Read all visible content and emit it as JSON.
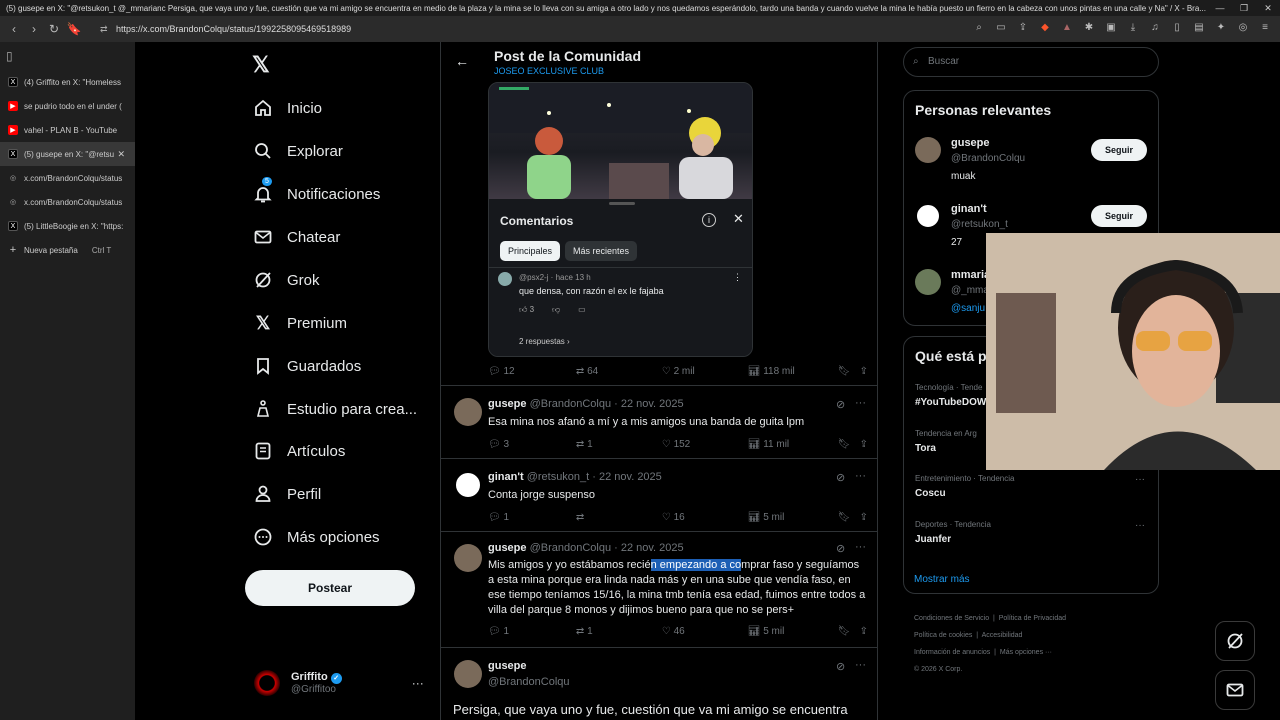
{
  "window_title": "(5) gusepe en X: \"@retsukon_t @_mmarianc Persiga, que vaya uno y fue, cuestión que va mi amigo se encuentra en medio de la plaza y la mina se lo lleva con su amiga a otro lado y nos quedamos esperándolo, tardo una banda y cuando vuelve la mina le había puesto un fierro en la cabeza con unos pintas en una calle y Na\" / X - Bra...",
  "url": "https://x.com/BrandonColqu/status/1992258095469518989",
  "tabs": [
    {
      "label": "(4) Griffito en X: \"Homeless",
      "icon": "x-favicon"
    },
    {
      "label": "se pudrio todo en el under (",
      "icon": "youtube-favicon"
    },
    {
      "label": "vahel - PLAN B - YouTube",
      "icon": "youtube-favicon"
    },
    {
      "label": "(5) gusepe en X: \"@retsu",
      "icon": "x-favicon",
      "active": true
    },
    {
      "label": "x.com/BrandonColqu/status",
      "icon": "globe-favicon"
    },
    {
      "label": "x.com/BrandonColqu/status",
      "icon": "globe-favicon"
    },
    {
      "label": "(5) LittleBoogie en X: \"https:",
      "icon": "x-favicon"
    }
  ],
  "new_tab": {
    "label": "Nueva pestaña",
    "shortcut": "Ctrl  T"
  },
  "nav": {
    "items": [
      {
        "label": "Inicio",
        "icon": "home-icon"
      },
      {
        "label": "Explorar",
        "icon": "search-icon"
      },
      {
        "label": "Notificaciones",
        "icon": "bell-icon",
        "badge": "5"
      },
      {
        "label": "Chatear",
        "icon": "mail-icon"
      },
      {
        "label": "Grok",
        "icon": "grok-icon"
      },
      {
        "label": "Premium",
        "icon": "x-logo-icon"
      },
      {
        "label": "Guardados",
        "icon": "bookmark-icon"
      },
      {
        "label": "Estudio para crea...",
        "icon": "studio-icon"
      },
      {
        "label": "Artículos",
        "icon": "article-icon"
      },
      {
        "label": "Perfil",
        "icon": "person-icon"
      },
      {
        "label": "Más opciones",
        "icon": "more-circle-icon"
      }
    ],
    "post_button": "Postear"
  },
  "account": {
    "name": "Griffito",
    "handle": "@Griffitoo"
  },
  "header": {
    "title": "Post de la Comunidad",
    "subtitle": "JOSEO EXCLUSIVE CLUB"
  },
  "comments_panel": {
    "title": "Comentarios",
    "tabs": [
      "Principales",
      "Más recientes"
    ],
    "comment_meta": "@psx2-j · hace 13 h",
    "comment_text": "que densa, con razón el ex le fajaba",
    "likes": "3",
    "replies": "2 respuestas"
  },
  "post_stats": {
    "replies": "12",
    "reposts": "64",
    "likes": "2 mil",
    "views": "118 mil"
  },
  "tweets": [
    {
      "name": "gusepe",
      "handle": "@BrandonColqu · 22 nov. 2025",
      "text": "Esa mina nos afanó a mí y a mis amigos una banda de guita lpm",
      "replies": "3",
      "reposts": "1",
      "likes": "152",
      "views": "11 mil"
    },
    {
      "name": "ginan't",
      "handle": "@retsukon_t · 22 nov. 2025",
      "text": "Conta jorge suspenso",
      "replies": "1",
      "reposts": "",
      "likes": "16",
      "views": "5 mil"
    },
    {
      "name": "gusepe",
      "handle": "@BrandonColqu · 22 nov. 2025",
      "text_before": "Mis amigos y yo estábamos recié",
      "text_highlight": "n empezando a co",
      "text_after": "mprar faso y seguíamos a esta mina porque era linda nada más y en una sube que vendía faso, en ese tiempo teníamos 15/16, la mina tmb tenía esa edad, fuimos entre todos a villa del parque 8 monos y dijimos bueno para que no se pers+",
      "replies": "1",
      "reposts": "1",
      "likes": "46",
      "views": "5 mil"
    },
    {
      "name": "gusepe",
      "handle": "@BrandonColqu",
      "text": "Persiga, que vaya uno y fue, cuestión que va mi amigo se encuentra en medio de la plaza y la mina se lo lleva con su amiga a otro lado y nos..."
    }
  ],
  "right": {
    "search_placeholder": "Buscar",
    "relevant_title": "Personas relevantes",
    "people": [
      {
        "name": "gusepe",
        "handle": "@BrandonColqu",
        "bio": "muak",
        "button": "Seguir"
      },
      {
        "name": "ginan't",
        "handle": "@retsukon_t",
        "bio": "27",
        "button": "Seguir"
      },
      {
        "name": "mmaria",
        "handle": "@_mmar",
        "bio": "@sanju"
      }
    ],
    "trends_title": "Qué está p",
    "trends": [
      {
        "category": "Tecnología · Tende",
        "name": "#YouTubeDOW"
      },
      {
        "category": "Tendencia en Arg",
        "name": "Tora"
      },
      {
        "category": "Entretenimiento · Tendencia",
        "name": "Coscu"
      },
      {
        "category": "Deportes · Tendencia",
        "name": "Juanfer"
      }
    ],
    "show_more": "Mostrar más",
    "footer": [
      "Condiciones de Servicio",
      "Política de Privacidad",
      "Política de cookies",
      "Accesibilidad",
      "Información de anuncios",
      "Más opciones ···",
      "© 2026 X Corp."
    ]
  }
}
